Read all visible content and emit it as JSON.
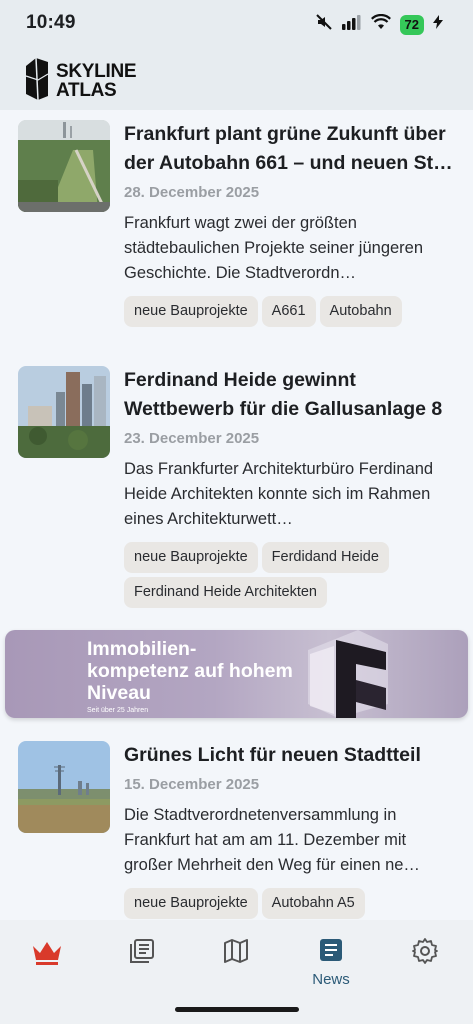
{
  "status_bar": {
    "time": "10:49",
    "battery": "72",
    "icons": [
      "mute-icon",
      "signal-icon",
      "wifi-icon",
      "battery-icon",
      "charging-icon"
    ]
  },
  "header": {
    "logo_line1": "SKYLINE",
    "logo_line2": "ATLAS"
  },
  "articles": [
    {
      "title": "Frankfurt plant grüne Zukunft über der Autobahn 661 – und neuen St…",
      "date": "28. December 2025",
      "excerpt": "Frankfurt wagt zwei der größten städtebaulichen Projekte seiner jüngeren Geschichte. Die Stadtverordn…",
      "tags": [
        "neue Bauprojekte",
        "A661",
        "Autobahn"
      ]
    },
    {
      "title": "Ferdinand Heide gewinnt Wettbewerb für die Gallusanlage 8",
      "date": "23. December 2025",
      "excerpt": "Das Frankfurter Architekturbüro Ferdinand Heide Architekten konnte sich im Rahmen eines Architekturwett…",
      "tags": [
        "neue Bauprojekte",
        "Ferdidand Heide",
        "Ferdinand Heide Architekten"
      ]
    },
    {
      "title": "Grünes Licht für neuen Stadtteil",
      "date": "15. December 2025",
      "excerpt": "Die Stadtverordnetenversammlung in Frankfurt hat am am 11. Dezember mit großer Mehrheit den Weg für einen ne…",
      "tags": [
        "neue Bauprojekte",
        "Autobahn A5"
      ]
    }
  ],
  "ad": {
    "headline": "Immobilien-kompetenz auf hohem Niveau",
    "subline": "Seit über 25 Jahren"
  },
  "nav": {
    "items": [
      {
        "icon": "crown-icon",
        "label": ""
      },
      {
        "icon": "articles-icon",
        "label": ""
      },
      {
        "icon": "map-icon",
        "label": ""
      },
      {
        "icon": "news-icon",
        "label": "News"
      },
      {
        "icon": "gear-icon",
        "label": ""
      }
    ],
    "active_color": "#2b5a77",
    "crown_color": "#d93a2b"
  }
}
